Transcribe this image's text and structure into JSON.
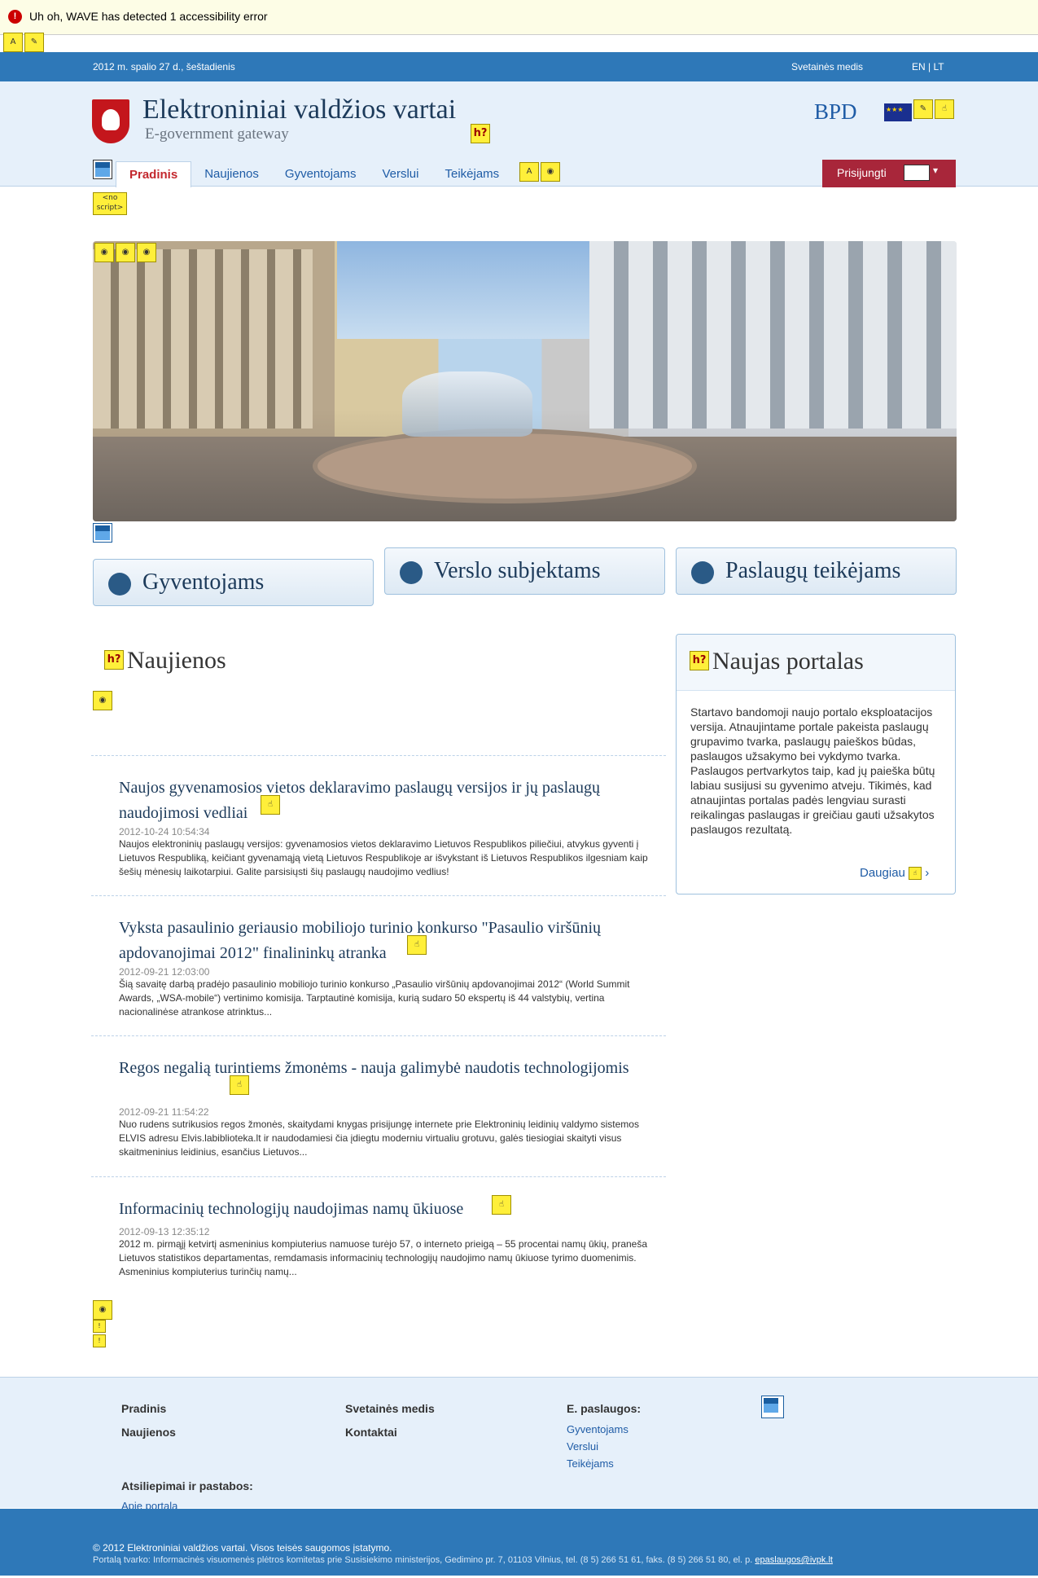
{
  "wave": {
    "message": "Uh oh, WAVE has detected 1 accessibility error",
    "error_icon": "error-icon"
  },
  "topbar": {
    "date": "2012 m. spalio 27 d., šeštadienis",
    "sitemap": "Svetainės medis",
    "lang": "EN  |  LT"
  },
  "header": {
    "title": "Elektroniniai valdžios vartai",
    "subtitle": "E-government gateway",
    "partner_logo": "BPD"
  },
  "nav": {
    "tabs": [
      "Pradinis",
      "Naujienos",
      "Gyventojams",
      "Verslui",
      "Teikėjams"
    ],
    "login": "Prisijungti"
  },
  "noscript": "<no script>",
  "categories": [
    "Gyventojams",
    "Verslo subjektams",
    "Paslaugų teikėjams"
  ],
  "news": {
    "heading": "Naujienos",
    "items": [
      {
        "title": "Naujos gyvenamosios vietos deklaravimo paslaugų versijos ir jų paslaugų naudojimosi vedliai",
        "timestamp": "2012-10-24 10:54:34",
        "body": "Naujos elektroninių paslaugų versijos: gyvenamosios vietos deklaravimo Lietuvos Respublikos piliečiui, atvykus gyventi į Lietuvos Respubliką, keičiant gyvenamąją vietą Lietuvos Respublikoje ar išvykstant iš Lietuvos Respublikos ilgesniam kaip šešių mėnesių laikotarpiui. Galite parsisiųsti šių paslaugų naudojimo vedlius!"
      },
      {
        "title": "Vyksta pasaulinio geriausio mobiliojo turinio konkurso \"Pasaulio viršūnių apdovanojimai 2012\" finalininkų atranka",
        "timestamp": "2012-09-21 12:03:00",
        "body": "Šią savaitę darbą pradėjo pasaulinio mobiliojo turinio konkurso „Pasaulio viršūnių apdovanojimai 2012“ (World Summit Awards, „WSA-mobile“) vertinimo komisija. Tarptautinė komisija, kurią sudaro 50 ekspertų iš 44 valstybių, vertina nacionalinėse atrankose atrinktus..."
      },
      {
        "title": "Regos negalią turintiems žmonėms - nauja galimybė naudotis technologijomis",
        "timestamp": "2012-09-21 11:54:22",
        "body": "Nuo rudens sutrikusios regos žmonės, skaitydami knygas prisijungę internete prie Elektroninių leidinių valdymo sistemos ELVIS adresu Elvis.labiblioteka.lt ir naudodamiesi čia įdiegtu moderniu virtualiu grotuvu, galės tiesiogiai skaityti visus skaitmeninius leidinius, esančius Lietuvos..."
      },
      {
        "title": "Informacinių technologijų naudojimas namų ūkiuose",
        "timestamp": "2012-09-13 12:35:12",
        "body": "2012 m. pirmąjį ketvirtį asmeninius kompiuterius namuose turėjo 57, o interneto prieigą – 55 procentai namų ūkių, praneša Lietuvos statistikos departamentas, remdamasis informacinių technologijų naudojimo namų ūkiuose tyrimo duomenimis. Asmeninius kompiuterius turinčių namų..."
      }
    ]
  },
  "sidebar": {
    "heading": "Naujas portalas",
    "text": "Startavo bandomoji naujo portalo eksploatacijos versija. Atnaujintame portale pakeista paslaugų grupavimo tvarka, paslaugų paieškos būdas, paslaugos užsakymo bei vykdymo tvarka. Paslaugos pertvarkytos taip, kad jų paieška būtų labiau susijusi su gyvenimo atveju. Tikimės, kad atnaujintas portalas padės lengviau surasti reikalingas paslaugas ir greičiau gauti užsakytos paslaugos rezultatą.",
    "more": "Daugiau",
    "more_arrow": "›"
  },
  "footer": {
    "col1": [
      "Pradinis",
      "Naujienos"
    ],
    "col2": [
      "Svetainės medis",
      "Kontaktai"
    ],
    "eservices_heading": "E. paslaugos:",
    "eservices": [
      "Gyventojams",
      "Verslui",
      "Teikėjams"
    ],
    "feedback_heading": "Atsiliepimai ir pastabos:",
    "feedback_link": "Apie portalą",
    "copyright": "© 2012 Elektroniniai valdžios vartai. Visos teisės saugomos įstatymo.",
    "maintainer": "Portalą tvarko: Informacinės visuomenės plėtros komitetas prie Susisiekimo ministerijos, Gedimino pr. 7, 01103 Vilnius, tel. (8 5) 266 51 61, faks. (8 5) 266 51 80, el. p.",
    "email": "epaslaugos@ivpk.lt"
  }
}
